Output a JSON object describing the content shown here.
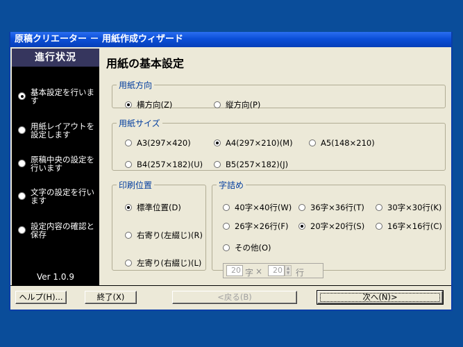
{
  "window": {
    "title": "原稿クリエーター － 用紙作成ウィザード"
  },
  "sidebar": {
    "header": "進行状況",
    "steps": [
      {
        "label": "基本設定を行います",
        "checked": true
      },
      {
        "label": "用紙レイアウトを設定します",
        "checked": false
      },
      {
        "label": "原稿中央の設定を行います",
        "checked": false
      },
      {
        "label": "文字の設定を行います",
        "checked": false
      },
      {
        "label": "設定内容の確認と保存",
        "checked": false
      }
    ],
    "version": "Ver 1.0.9"
  },
  "main": {
    "title": "用紙の基本設定",
    "orientation": {
      "legend": "用紙方向",
      "options": [
        "横方向(Z)",
        "縦方向(P)"
      ],
      "selected": 0
    },
    "paper_size": {
      "legend": "用紙サイズ",
      "options": [
        "A3(297×420)",
        "A4(297×210)(M)",
        "A5(148×210)",
        "B4(257×182)(U)",
        "B5(257×182)(J)"
      ],
      "selected": 1
    },
    "print_position": {
      "legend": "印刷位置",
      "options": [
        "標準位置(D)",
        "右寄り(左綴じ)(R)",
        "左寄り(右綴じ)(L)"
      ],
      "selected": 0
    },
    "char_packing": {
      "legend": "字詰め",
      "options": [
        "40字×40行(W)",
        "36字×36行(T)",
        "30字×30行(K)",
        "26字×26行(F)",
        "20字×20行(S)",
        "16字×16行(C)",
        "その他(O)"
      ],
      "selected": 4,
      "custom": {
        "chars": "20",
        "chars_unit": "字",
        "times": "×",
        "lines": "20",
        "lines_unit": "行"
      }
    }
  },
  "buttons": {
    "help": "ヘルプ(H)...",
    "exit": "終了(X)",
    "back": "<戻る(B)",
    "next": "次へ(N)>"
  }
}
